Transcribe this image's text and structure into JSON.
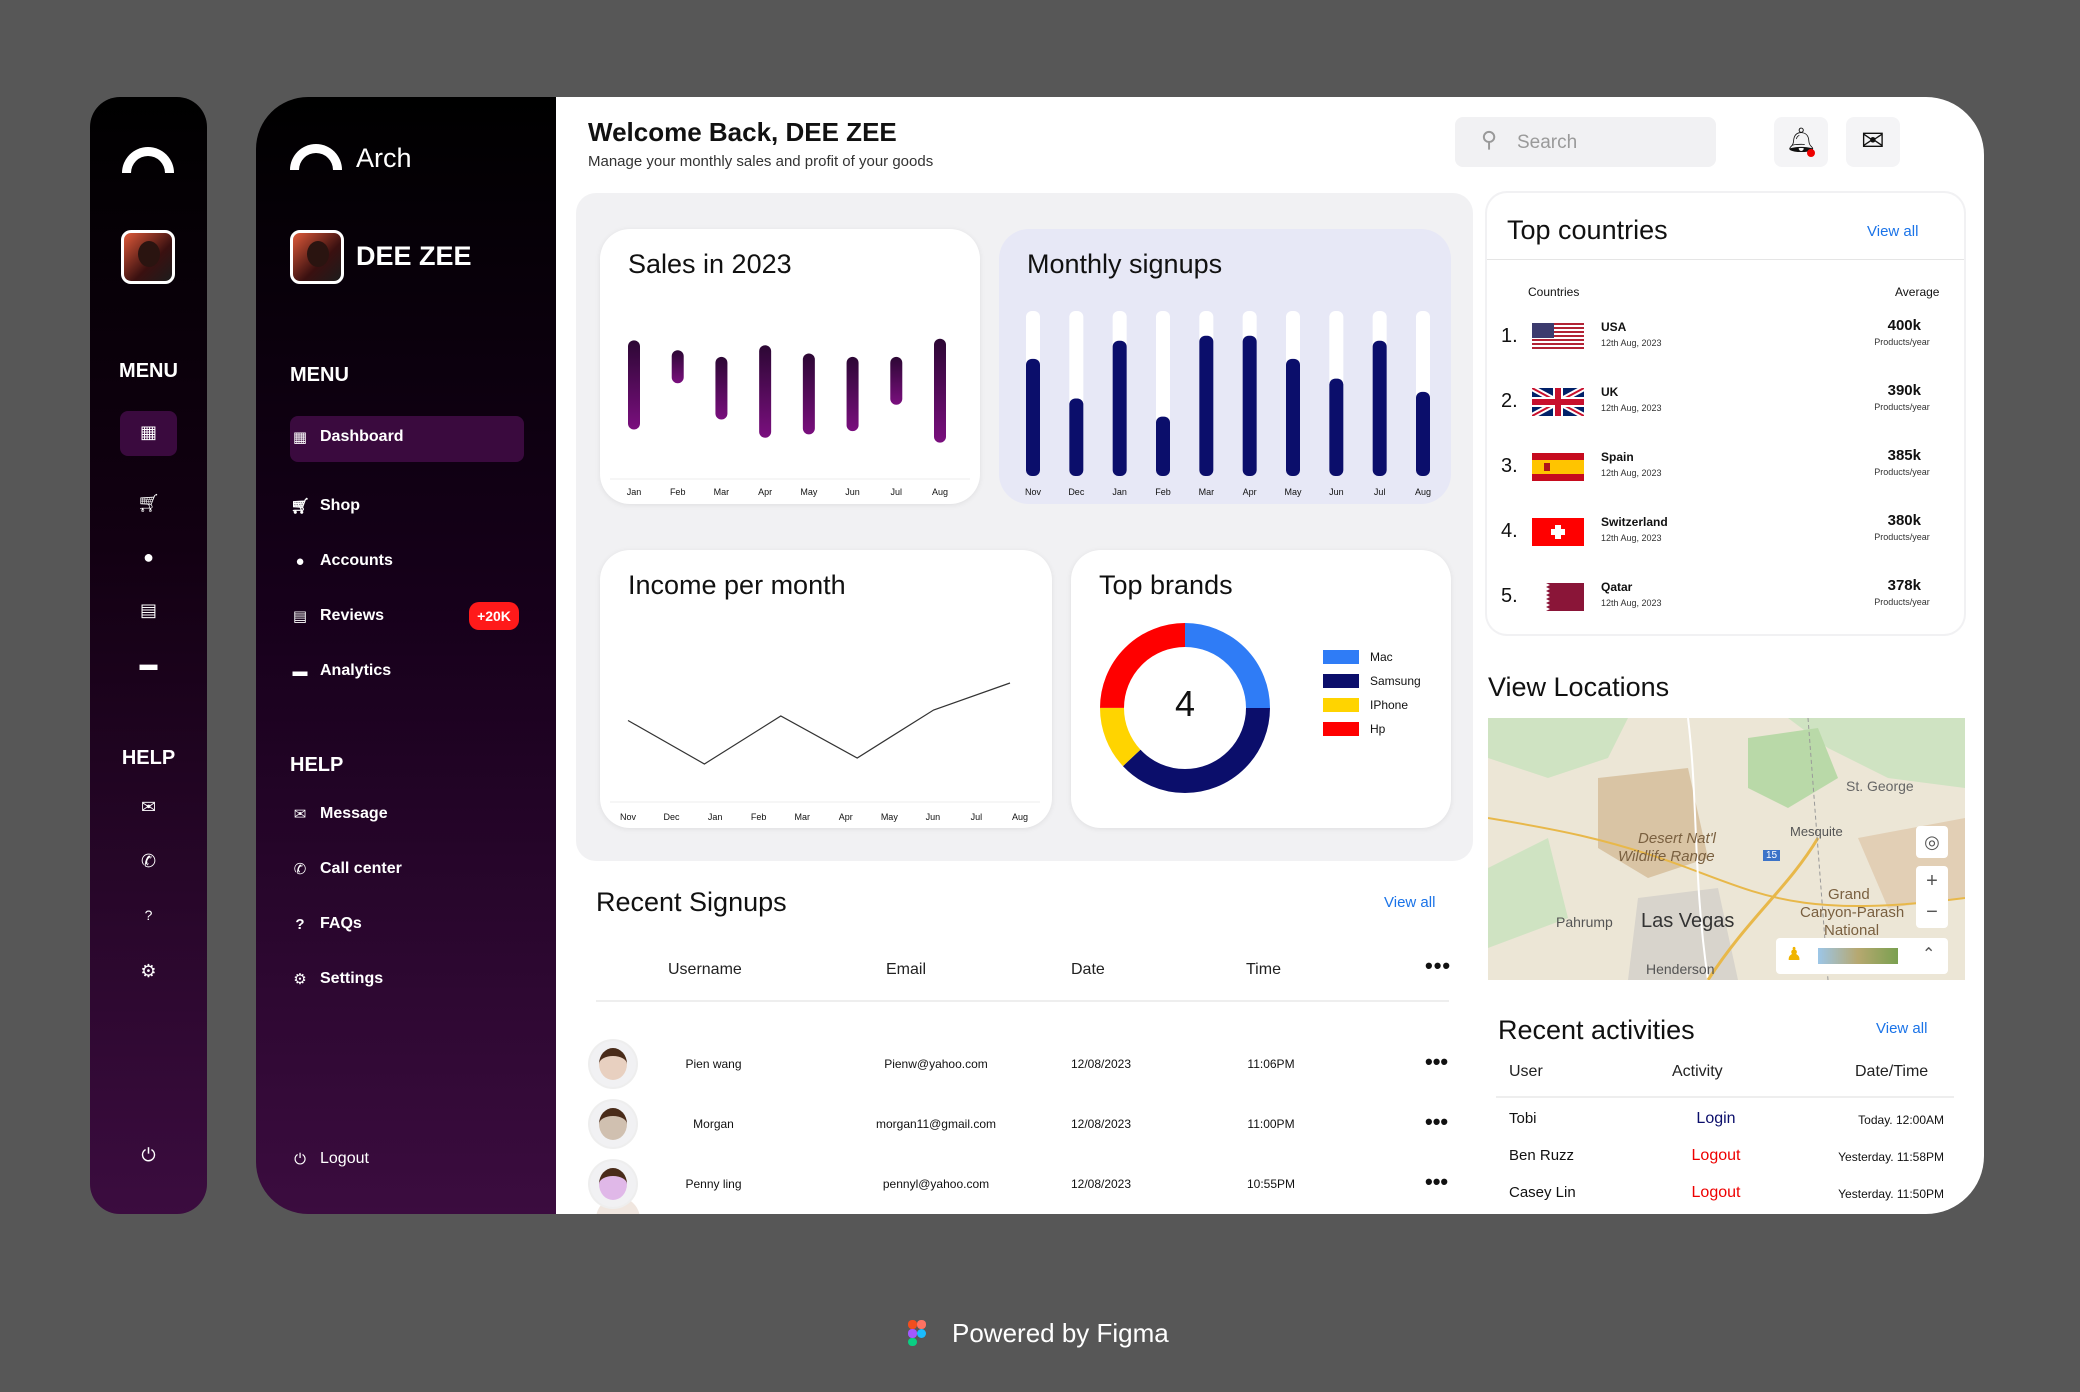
{
  "mini": {
    "menu": "MENU",
    "help": "HELP"
  },
  "brand": {
    "name": "Arch",
    "user": "DEE ZEE"
  },
  "sidebar": {
    "menu_title": "MENU",
    "help_title": "HELP",
    "items": [
      {
        "label": "Dashboard",
        "icon": "grid-icon"
      },
      {
        "label": "Shop",
        "icon": "cart-icon"
      },
      {
        "label": "Accounts",
        "icon": "user-icon"
      },
      {
        "label": "Reviews",
        "icon": "chat-icon",
        "badge": "+20K"
      },
      {
        "label": "Analytics",
        "icon": "folder-icon"
      }
    ],
    "help_items": [
      {
        "label": "Message",
        "icon": "mail-icon"
      },
      {
        "label": "Call center",
        "icon": "phone-icon"
      },
      {
        "label": "FAQs",
        "icon": "question-icon"
      },
      {
        "label": "Settings",
        "icon": "gear-icon"
      }
    ],
    "logout": "Logout"
  },
  "header": {
    "title": "Welcome Back, DEE ZEE",
    "subtitle": "Manage your monthly sales and profit of your goods",
    "search_placeholder": "Search"
  },
  "chart_data": [
    {
      "type": "bar",
      "title": "Sales in 2023",
      "categories": [
        "Jan",
        "Feb",
        "Mar",
        "Apr",
        "May",
        "Jun",
        "Jul",
        "Aug"
      ],
      "ranges": [
        [
          0.27,
          0.81
        ],
        [
          0.55,
          0.75
        ],
        [
          0.33,
          0.71
        ],
        [
          0.22,
          0.78
        ],
        [
          0.24,
          0.73
        ],
        [
          0.26,
          0.71
        ],
        [
          0.42,
          0.71
        ],
        [
          0.19,
          0.82
        ]
      ],
      "ylim": [
        0,
        1
      ]
    },
    {
      "type": "bar",
      "title": "Monthly signups",
      "categories": [
        "Nov",
        "Dec",
        "Jan",
        "Feb",
        "Mar",
        "Apr",
        "May",
        "Jun",
        "Jul",
        "Aug"
      ],
      "values": [
        0.71,
        0.47,
        0.82,
        0.36,
        0.85,
        0.85,
        0.71,
        0.59,
        0.82,
        0.51
      ],
      "ylim": [
        0,
        1
      ]
    },
    {
      "type": "line",
      "title": "Income per month",
      "categories": [
        "Nov",
        "Dec",
        "Jan",
        "Feb",
        "Mar",
        "Apr",
        "May",
        "Jun",
        "Jul",
        "Aug"
      ],
      "values": [
        0.53,
        0.24,
        0.56,
        0.28,
        0.6,
        0.78
      ]
    },
    {
      "type": "pie",
      "title": "Top brands",
      "center_label": "4",
      "slices": [
        {
          "name": "Mac",
          "value": 25,
          "color": "#2f7cf6"
        },
        {
          "name": "Samsung",
          "value": 38,
          "color": "#0b0e6b"
        },
        {
          "name": "IPhone",
          "value": 12,
          "color": "#ffd400"
        },
        {
          "name": "Hp",
          "value": 25,
          "color": "#ff0000"
        }
      ]
    }
  ],
  "countries": {
    "title": "Top countries",
    "view_all": "View all",
    "col_country": "Countries",
    "col_avg": "Average",
    "rows": [
      {
        "rank": "1.",
        "name": "USA",
        "date": "12th Aug, 2023",
        "value": "400k",
        "unit": "Products/year"
      },
      {
        "rank": "2.",
        "name": "UK",
        "date": "12th Aug, 2023",
        "value": "390k",
        "unit": "Products/year"
      },
      {
        "rank": "3.",
        "name": "Spain",
        "date": "12th Aug, 2023",
        "value": "385k",
        "unit": "Products/year"
      },
      {
        "rank": "4.",
        "name": "Switzerland",
        "date": "12th Aug, 2023",
        "value": "380k",
        "unit": "Products/year"
      },
      {
        "rank": "5.",
        "name": "Qatar",
        "date": "12th Aug, 2023",
        "value": "378k",
        "unit": "Products/year"
      }
    ]
  },
  "locations": {
    "title": "View Locations",
    "labels": {
      "st_george": "St. George",
      "mesquite": "Mesquite",
      "desert": "Desert Nat'l",
      "wildlife": "Wildlife Range",
      "grand": "Grand",
      "canyon": "Canyon-Parash",
      "national": "National",
      "pahrump": "Pahrump",
      "las_vegas": "Las Vegas",
      "henderson": "Henderson",
      "route": "15"
    }
  },
  "signups": {
    "title": "Recent Signups",
    "view_all": "View all",
    "headers": [
      "Username",
      "Email",
      "Date",
      "Time"
    ],
    "rows": [
      {
        "user": "Pien wang",
        "email": "Pienw@yahoo.com",
        "date": "12/08/2023",
        "time": "11:06PM"
      },
      {
        "user": "Morgan",
        "email": "morgan11@gmail.com",
        "date": "12/08/2023",
        "time": "11:00PM"
      },
      {
        "user": "Penny ling",
        "email": "pennyl@yahoo.com",
        "date": "12/08/2023",
        "time": "10:55PM"
      }
    ]
  },
  "activities": {
    "title": "Recent activities",
    "view_all": "View all",
    "headers": [
      "User",
      "Activity",
      "Date/Time"
    ],
    "rows": [
      {
        "user": "Tobi",
        "activity": "Login",
        "time": "Today. 12:00AM"
      },
      {
        "user": "Ben Ruzz",
        "activity": "Logout",
        "time": "Yesterday. 11:58PM"
      },
      {
        "user": "Casey Lin",
        "activity": "Logout",
        "time": "Yesterday. 11:50PM"
      }
    ]
  },
  "footer": {
    "powered": "Powered by Figma"
  }
}
